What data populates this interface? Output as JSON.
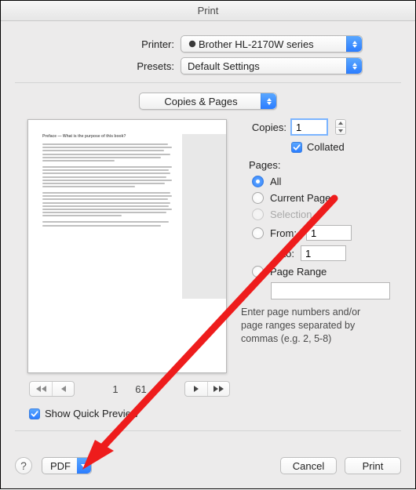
{
  "window": {
    "title": "Print"
  },
  "top": {
    "printer_label": "Printer:",
    "printer_value": "Brother HL-2170W series",
    "presets_label": "Presets:",
    "presets_value": "Default Settings",
    "panel_value": "Copies & Pages"
  },
  "preview": {
    "page_indicator_prefix": "1",
    "page_indicator_total": "61",
    "show_quick_preview_label": "Show Quick Preview",
    "show_quick_preview_checked": true
  },
  "options": {
    "copies_label": "Copies:",
    "copies_value": "1",
    "collated_label": "Collated",
    "collated_checked": true,
    "pages_label": "Pages:",
    "radios": {
      "all": "All",
      "current": "Current Page",
      "selection": "Selection",
      "from": "From:",
      "to_label": "to:",
      "from_value": "1",
      "to_value": "1",
      "range": "Page Range"
    },
    "range_value": "",
    "hint": "Enter page numbers and/or page ranges separated by commas (e.g. 2, 5-8)"
  },
  "footer": {
    "pdf_label": "PDF",
    "cancel": "Cancel",
    "print": "Print",
    "help": "?"
  }
}
